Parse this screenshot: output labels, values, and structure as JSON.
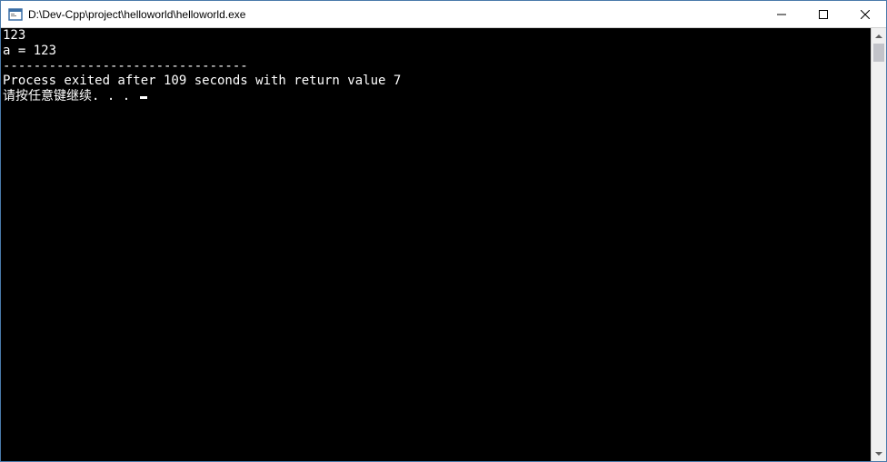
{
  "window": {
    "title": "D:\\Dev-Cpp\\project\\helloworld\\helloworld.exe"
  },
  "console": {
    "line1": "123",
    "line2": "a = 123",
    "separator": "--------------------------------",
    "exit_message": "Process exited after 109 seconds with return value 7",
    "continue_prompt": "请按任意键继续. . . "
  }
}
